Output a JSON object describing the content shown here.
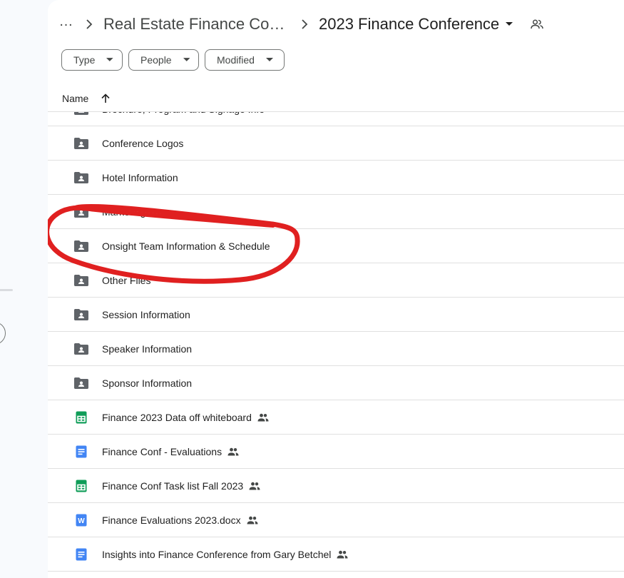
{
  "breadcrumb": {
    "more_label": "…",
    "parent": "Real Estate Finance Co…",
    "current": "2023 Finance Conference"
  },
  "filters": [
    {
      "label": "Type"
    },
    {
      "label": "People"
    },
    {
      "label": "Modified"
    }
  ],
  "list_header": {
    "name_label": "Name",
    "sort": "ascending"
  },
  "rows": [
    {
      "name": "Brochure, Program and Signage Info",
      "kind": "shared-folder",
      "shared": false
    },
    {
      "name": "Conference Logos",
      "kind": "shared-folder",
      "shared": false
    },
    {
      "name": "Hotel Information",
      "kind": "shared-folder",
      "shared": false
    },
    {
      "name": "Marketing",
      "kind": "shared-folder",
      "shared": false
    },
    {
      "name": "Onsight Team Information & Schedule",
      "kind": "shared-folder",
      "shared": false
    },
    {
      "name": "Other Files",
      "kind": "shared-folder",
      "shared": false
    },
    {
      "name": "Session Information",
      "kind": "shared-folder",
      "shared": false
    },
    {
      "name": "Speaker Information",
      "kind": "shared-folder",
      "shared": false
    },
    {
      "name": "Sponsor Information",
      "kind": "shared-folder",
      "shared": false
    },
    {
      "name": "Finance 2023 Data off whiteboard",
      "kind": "sheets",
      "shared": true
    },
    {
      "name": "Finance Conf - Evaluations",
      "kind": "docs",
      "shared": true
    },
    {
      "name": "Finance Conf Task list Fall 2023",
      "kind": "sheets",
      "shared": true
    },
    {
      "name": "Finance Evaluations 2023.docx",
      "kind": "word",
      "shared": true
    },
    {
      "name": "Insights into Finance Conference from Gary Betchel",
      "kind": "docs",
      "shared": true
    }
  ],
  "colors": {
    "accent_sheets": "#0f9d58",
    "accent_docs": "#4285f4",
    "folder": "#5f6368",
    "annotation_red": "#e02020"
  },
  "icons": {
    "more": "more-horizontal-icon",
    "separator": "chevron-right-icon",
    "caret": "caret-down-icon",
    "shared": "people-icon",
    "sort": "arrow-up-icon"
  }
}
